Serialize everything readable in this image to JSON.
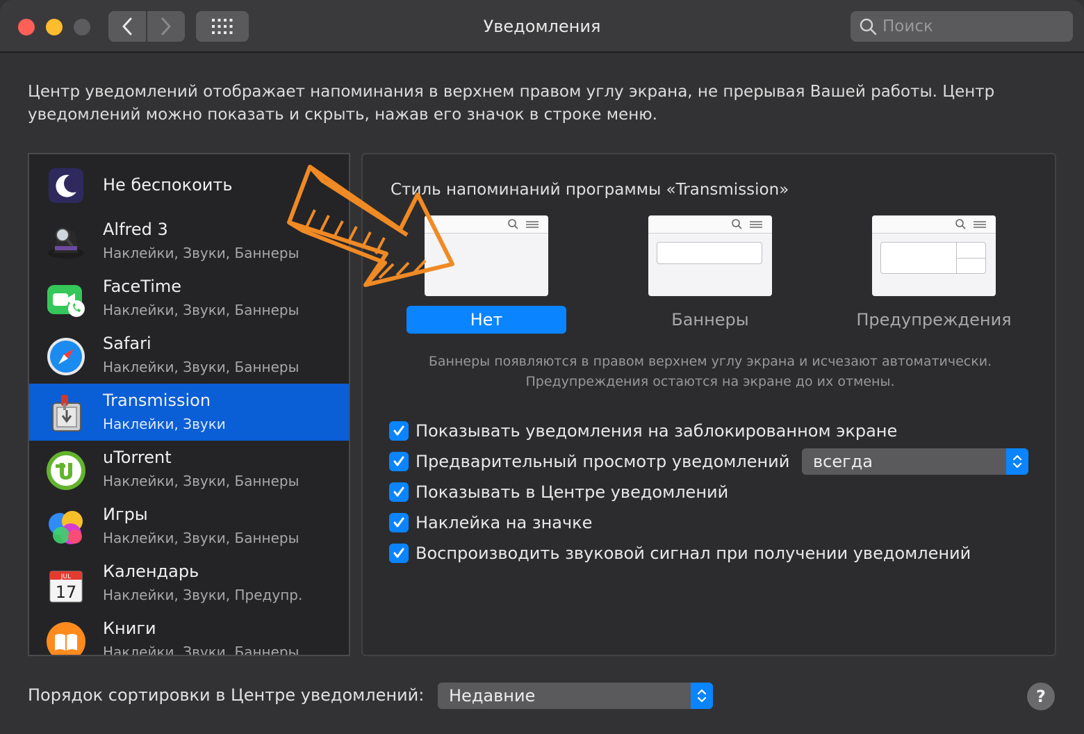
{
  "window": {
    "title": "Уведомления",
    "search_placeholder": "Поиск"
  },
  "description": "Центр уведомлений отображает напоминания в верхнем правом углу экрана, не прерывая Вашей работы. Центр уведомлений можно показать и скрыть, нажав его значок в строке меню.",
  "apps": [
    {
      "name": "Не беспокоить",
      "sub": "",
      "icon": "moon-icon"
    },
    {
      "name": "Alfred 3",
      "sub": "Наклейки, Звуки, Баннеры",
      "icon": "alfred-icon"
    },
    {
      "name": "FaceTime",
      "sub": "Наклейки, Звуки, Баннеры",
      "icon": "facetime-icon"
    },
    {
      "name": "Safari",
      "sub": "Наклейки, Звуки, Баннеры",
      "icon": "safari-icon"
    },
    {
      "name": "Transmission",
      "sub": "Наклейки, Звуки",
      "icon": "transmission-icon",
      "selected": true
    },
    {
      "name": "uTorrent",
      "sub": "Наклейки, Звуки, Баннеры",
      "icon": "utorrent-icon"
    },
    {
      "name": "Игры",
      "sub": "Наклейки, Звуки, Баннеры",
      "icon": "game-center-icon"
    },
    {
      "name": "Календарь",
      "sub": "Наклейки, Звуки, Предупр.",
      "icon": "calendar-icon",
      "calendar_month": "JUL",
      "calendar_day": "17"
    },
    {
      "name": "Книги",
      "sub": "Наклейки, Звуки, Баннеры",
      "icon": "books-icon"
    }
  ],
  "panel": {
    "style_title": "Стиль напоминаний программы «Transmission»",
    "styles": [
      {
        "label": "Нет",
        "active": true
      },
      {
        "label": "Баннеры",
        "active": false
      },
      {
        "label": "Предупреждения",
        "active": false
      }
    ],
    "hint_line1": "Баннеры появляются в правом верхнем углу экрана и исчезают автоматически.",
    "hint_line2": "Предупреждения остаются на экране до их отмены.",
    "checks": [
      {
        "label": "Показывать уведомления на заблокированном экране",
        "checked": true
      },
      {
        "label": "Предварительный просмотр уведомлений",
        "checked": true
      },
      {
        "label": "Показывать в Центре уведомлений",
        "checked": true
      },
      {
        "label": "Наклейка на значке",
        "checked": true
      },
      {
        "label": "Воспроизводить звуковой сигнал при получении уведомлений",
        "checked": true
      }
    ],
    "preview_select": "всегда"
  },
  "bottom": {
    "sort_label": "Порядок сортировки в Центре уведомлений:",
    "sort_select": "Недавние",
    "help": "?"
  },
  "colors": {
    "accent": "#0a84ff",
    "selection": "#0a5ed6",
    "annotation_arrow": "#f08a24"
  }
}
